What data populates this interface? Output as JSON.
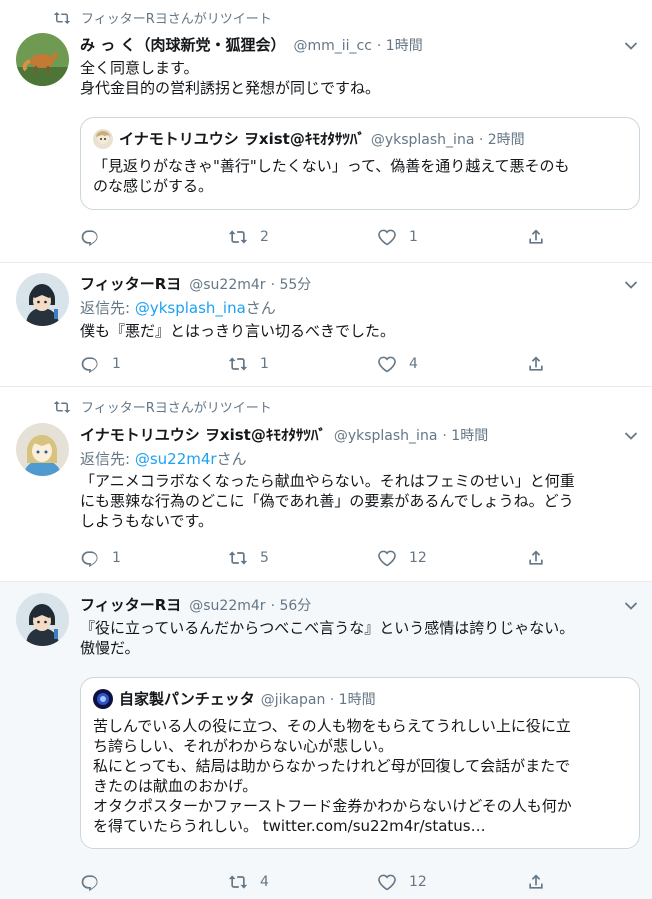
{
  "tweets": [
    {
      "retweeted_by": "フィッターRヨさんがリツイート",
      "name": "み っ く（肉球新党・狐狸会）",
      "handle": "@mm_ii_cc",
      "time": "· 1時間",
      "text": "全く同意します。\n身代金目的の営利誘拐と発想が同じですね。",
      "quote": {
        "name": "イナモトリユウシ ヲxist@ｷﾓｵﾀｻﾂﾊﾞ",
        "handle": "@yksplash_ina · 2時間",
        "text": "「見返りがなきゃ\"善行\"したくない」って、偽善を通り越えて悪そのも\nのな感じがする。"
      },
      "replies": "",
      "retweets": "2",
      "likes": "1"
    },
    {
      "name": "フィッターRヨ",
      "handle": "@su22m4r",
      "time": "· 55分",
      "reply_prefix": "返信先: ",
      "reply_link": "@yksplash_ina",
      "reply_suffix": "さん",
      "text": "僕も『悪だ』とはっきり言い切るべきでした。",
      "replies": "1",
      "retweets": "1",
      "likes": "4"
    },
    {
      "retweeted_by": "フィッターRヨさんがリツイート",
      "name": "イナモトリユウシ ヲxist@ｷﾓｵﾀｻﾂﾊﾞ",
      "handle": "@yksplash_ina",
      "time": "· 1時間",
      "reply_prefix": "返信先: ",
      "reply_link": "@su22m4r",
      "reply_suffix": "さん",
      "text": "「アニメコラボなくなったら献血やらない。それはフェミのせい」と何重\nにも悪辣な行為のどこに「偽であれ善」の要素があるんでしょうね。どう\nしようもないです。",
      "replies": "1",
      "retweets": "5",
      "likes": "12"
    },
    {
      "name": "フィッターRヨ",
      "handle": "@su22m4r",
      "time": "· 56分",
      "text": "『役に立っているんだからつべこべ言うな』という感情は誇りじゃない。\n傲慢だ。",
      "quote": {
        "name": "自家製パンチェッタ",
        "handle": "@jikapan · 1時間",
        "text": "苦しんでいる人の役に立つ、その人も物をもらえてうれしい上に役に立\nち誇らしい、それがわからない心が悲しい。\n私にとっても、結局は助からなかったけれど母が回復して会話がまたで\nきたのは献血のおかげ。\nオタクポスターかファーストフード金券かわからないけどその人も何か\nを得ていたらうれしい。 twitter.com/su22m4r/status…"
      },
      "replies": "",
      "retweets": "4",
      "likes": "12"
    }
  ],
  "colors": {
    "accent": "#1da1f2",
    "muted": "#657786",
    "border": "#e6ecf0",
    "highlight_bg": "#f5f8fa"
  }
}
